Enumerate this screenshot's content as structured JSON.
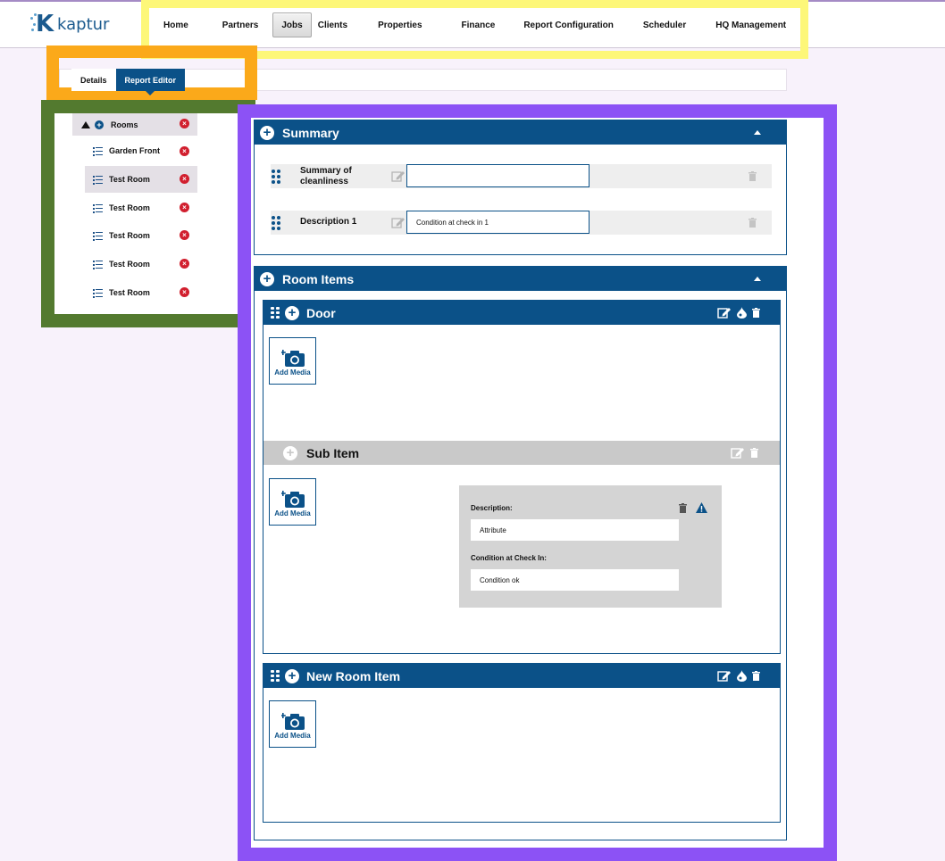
{
  "app": {
    "logo_text": "kaptur"
  },
  "nav": {
    "items": [
      "Home",
      "Partners",
      "Jobs",
      "Clients",
      "Properties",
      "Finance",
      "Report Configuration",
      "Scheduler",
      "HQ Management"
    ],
    "active": "Jobs"
  },
  "tabs": {
    "details": "Details",
    "report_editor": "Report Editor",
    "active": "Report Editor"
  },
  "tree": {
    "root": "Rooms",
    "items": [
      "Garden Front",
      "Test Room",
      "Test Room",
      "Test Room",
      "Test Room",
      "Test Room"
    ],
    "selected_index": 1
  },
  "summary": {
    "title": "Summary",
    "fields": [
      {
        "label": "Summary of cleanliness",
        "value": ""
      },
      {
        "label": "Description 1",
        "value": "Condition at check in 1"
      }
    ]
  },
  "room_items": {
    "title": "Room Items",
    "door": {
      "title": "Door",
      "add_media": "Add Media",
      "sub_item": {
        "title": "Sub Item",
        "add_media": "Add Media",
        "description_label": "Description:",
        "description_value": "Attribute",
        "condition_label": "Condition at Check In:",
        "condition_value": "Condition ok"
      }
    },
    "new_room_item": {
      "title": "New Room Item",
      "add_media": "Add Media"
    }
  },
  "colors": {
    "primary": "#0b5188",
    "danger": "#d11f2e",
    "highlight_nav": "#fdf779",
    "highlight_tabs": "#fba91a",
    "highlight_tree": "#537a2f",
    "highlight_main": "#8c52f5"
  }
}
